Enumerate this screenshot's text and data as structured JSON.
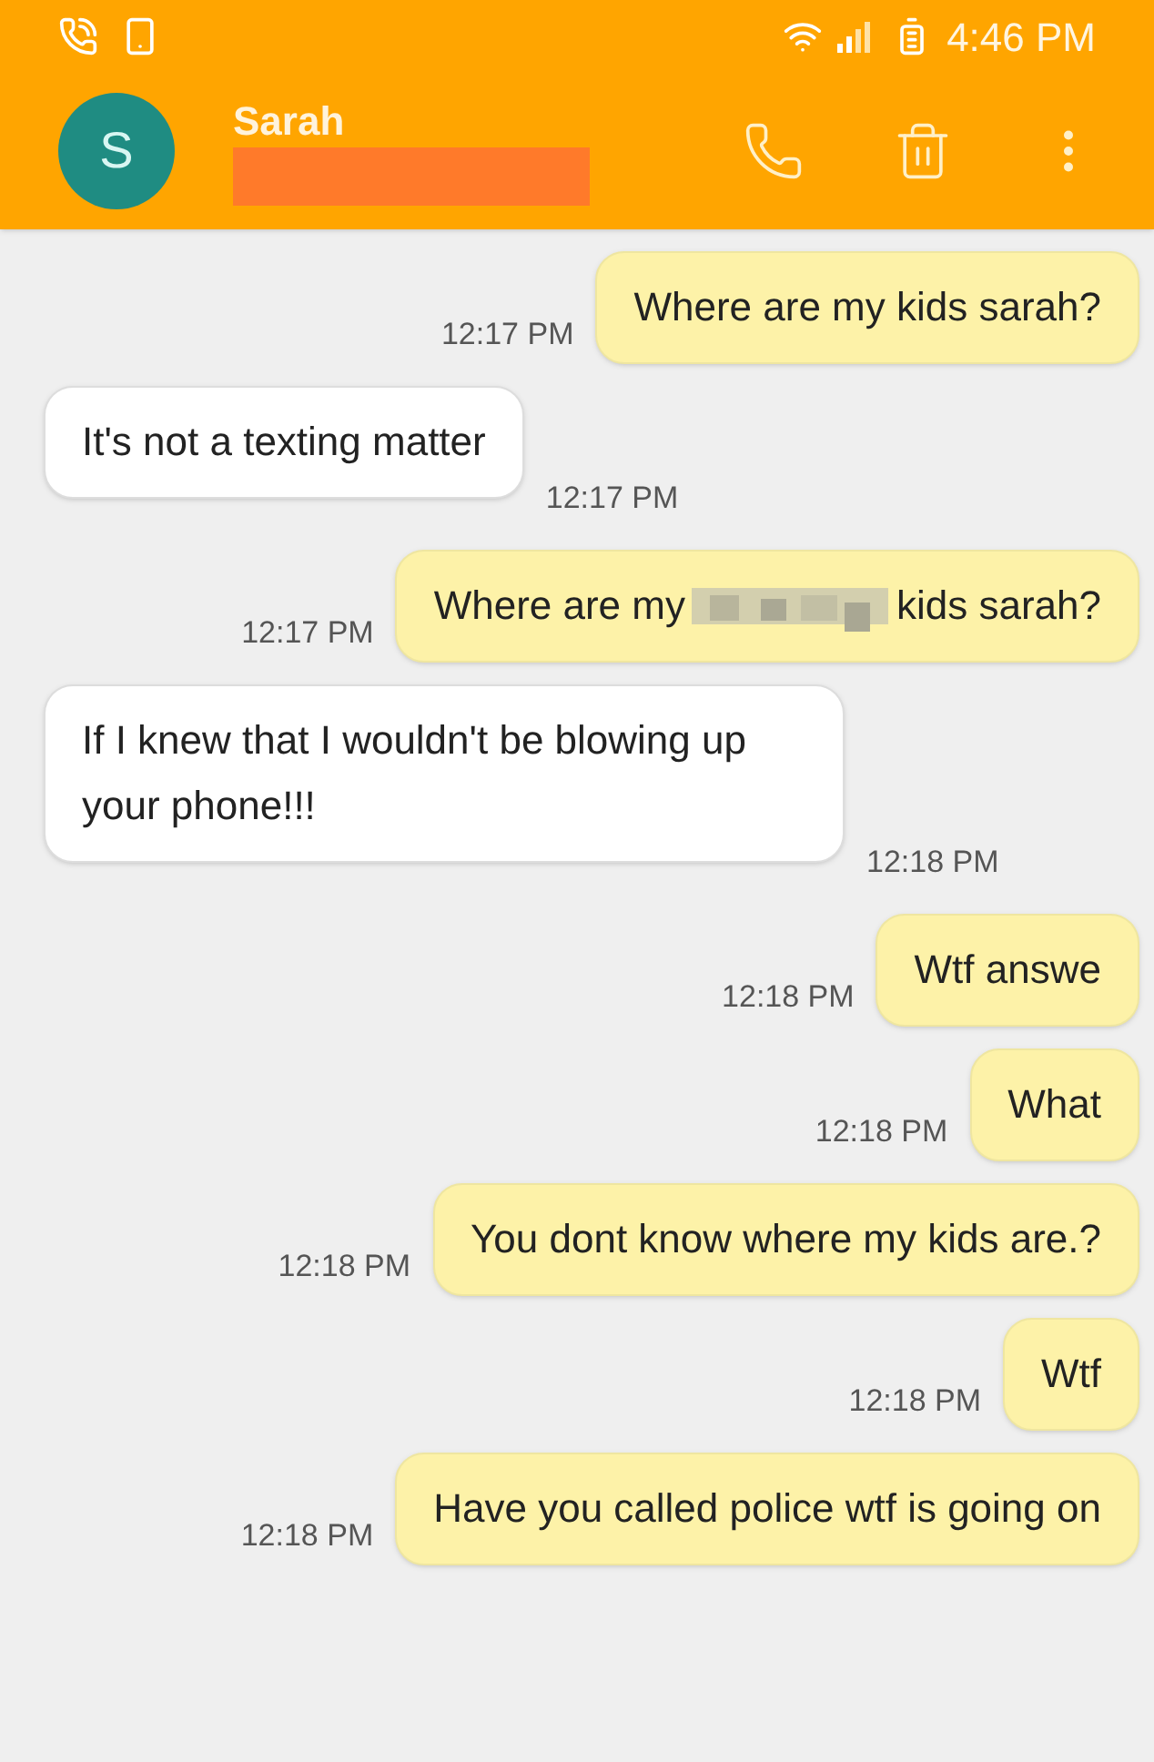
{
  "status_bar": {
    "time": "4:46 PM"
  },
  "header": {
    "avatar_letter": "S",
    "contact_name": "Sarah",
    "number_redacted": true
  },
  "messages": [
    {
      "kind": "sent",
      "segments": [
        {
          "kind": "text",
          "text": "Where are my kids sarah?"
        }
      ],
      "time": "12:17 PM"
    },
    {
      "kind": "received",
      "segments": [
        {
          "kind": "text",
          "text": "It's not a texting matter"
        }
      ],
      "time": "12:17 PM"
    },
    {
      "kind": "sent",
      "segments": [
        {
          "kind": "text",
          "text": "Where are my"
        },
        {
          "kind": "censored"
        },
        {
          "kind": "text",
          "text": "kids sarah?"
        }
      ],
      "time": "12:17 PM"
    },
    {
      "kind": "received",
      "segments": [
        {
          "kind": "text",
          "text": "If I knew that I wouldn't be blowing up your phone!!!"
        }
      ],
      "time": "12:18 PM"
    },
    {
      "kind": "sent",
      "segments": [
        {
          "kind": "text",
          "text": "Wtf answe"
        }
      ],
      "time": "12:18 PM"
    },
    {
      "kind": "sent",
      "segments": [
        {
          "kind": "text",
          "text": "What"
        }
      ],
      "time": "12:18 PM"
    },
    {
      "kind": "sent",
      "segments": [
        {
          "kind": "text",
          "text": "You dont know where my kids are.?"
        }
      ],
      "time": "12:18 PM"
    },
    {
      "kind": "sent",
      "segments": [
        {
          "kind": "text",
          "text": "Wtf"
        }
      ],
      "time": "12:18 PM"
    },
    {
      "kind": "sent",
      "segments": [
        {
          "kind": "text",
          "text": "Have you called police wtf is going on"
        }
      ],
      "time": "12:18 PM"
    }
  ]
}
